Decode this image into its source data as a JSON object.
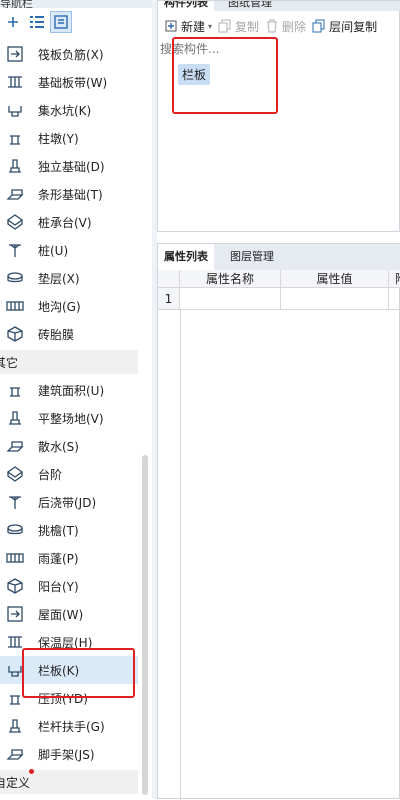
{
  "left_panel": {
    "top_title": "导航栏",
    "toolbar": {
      "add_icon": "plus-icon",
      "list_icon": "list-icon",
      "grid_icon": "tile-icon"
    },
    "items": [
      {
        "label": "筏板负筋(X)",
        "icon": "raft-negative-rebar-icon"
      },
      {
        "label": "基础板带(W)",
        "icon": "foundation-strip-icon"
      },
      {
        "label": "集水坑(K)",
        "icon": "sump-pit-icon"
      },
      {
        "label": "柱墩(Y)",
        "icon": "column-pier-icon"
      },
      {
        "label": "独立基础(D)",
        "icon": "isolated-footing-icon"
      },
      {
        "label": "条形基础(T)",
        "icon": "strip-footing-icon"
      },
      {
        "label": "桩承台(V)",
        "icon": "pile-cap-icon"
      },
      {
        "label": "桩(U)",
        "icon": "pile-icon"
      },
      {
        "label": "垫层(X)",
        "icon": "cushion-layer-icon"
      },
      {
        "label": "地沟(G)",
        "icon": "trench-icon"
      },
      {
        "label": "砖胎膜",
        "icon": "brick-membrane-icon"
      }
    ],
    "group_other": "其它",
    "items_other": [
      {
        "label": "建筑面积(U)",
        "icon": "building-area-icon"
      },
      {
        "label": "平整场地(V)",
        "icon": "site-leveling-icon"
      },
      {
        "label": "散水(S)",
        "icon": "apron-icon"
      },
      {
        "label": "台阶",
        "icon": "steps-icon"
      },
      {
        "label": "后浇带(JD)",
        "icon": "post-cast-strip-icon"
      },
      {
        "label": "挑檐(T)",
        "icon": "cornice-icon"
      },
      {
        "label": "雨蓬(P)",
        "icon": "canopy-icon"
      },
      {
        "label": "阳台(Y)",
        "icon": "balcony-icon"
      },
      {
        "label": "屋面(W)",
        "icon": "roof-icon"
      },
      {
        "label": "保温层(H)",
        "icon": "insulation-icon"
      },
      {
        "label": "栏板(K)",
        "icon": "parapet-panel-icon"
      },
      {
        "label": "压顶(YD)",
        "icon": "coping-icon"
      },
      {
        "label": "栏杆扶手(G)",
        "icon": "railing-icon"
      },
      {
        "label": "脚手架(JS)",
        "icon": "scaffold-icon"
      }
    ],
    "group_custom": "自定义"
  },
  "right_panel": {
    "top_tabs": [
      "构件列表",
      "图纸管理"
    ],
    "toolbar": {
      "new_label": "新建",
      "copy_label": "复制",
      "delete_label": "删除",
      "floor_copy_label": "层间复制"
    },
    "search_placeholder": "搜索构件...",
    "component_chip": "栏板",
    "bottom_tabs": [
      "属性列表",
      "图层管理"
    ],
    "grid_headers": [
      "属性名称",
      "属性值",
      "附加"
    ],
    "grid_rows": [
      "1"
    ]
  },
  "colors": {
    "highlight_box": "#e02020",
    "selection": "#dbeaf9",
    "chip": "#c9def5"
  }
}
